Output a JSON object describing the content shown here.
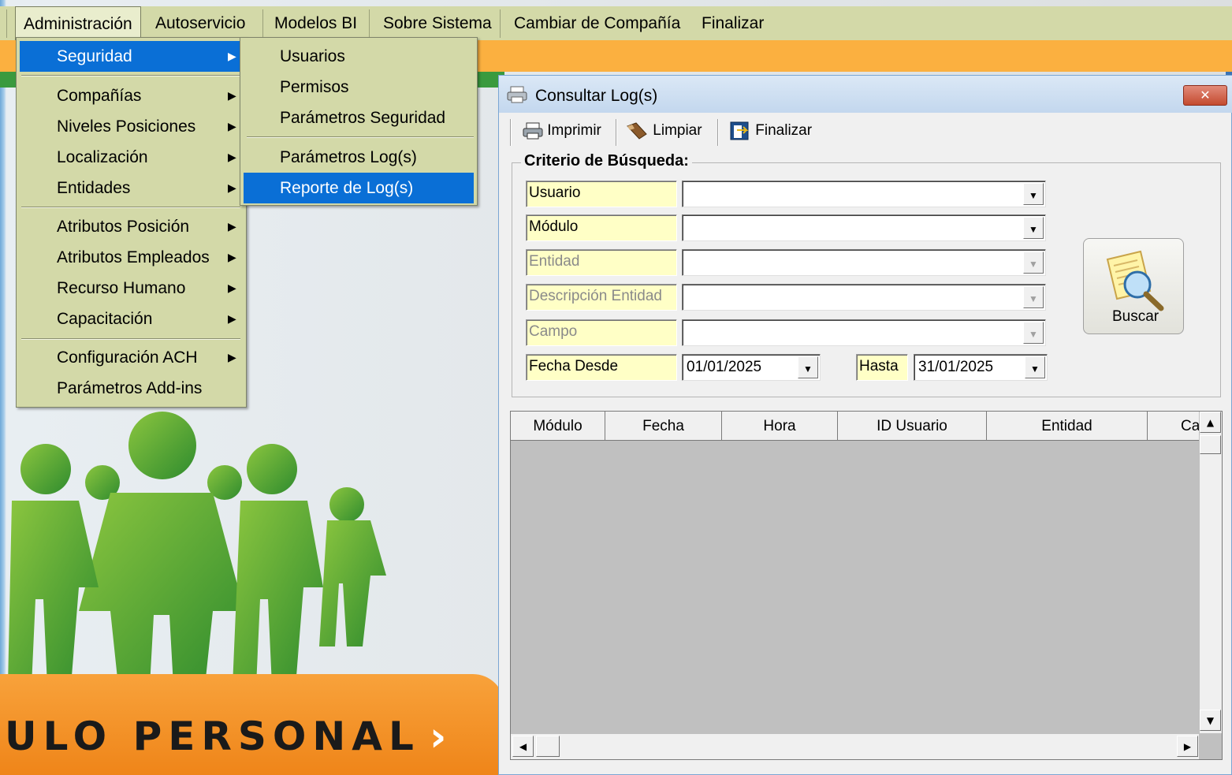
{
  "menubar": {
    "items": [
      "Administración",
      "Autoservicio",
      "Modelos BI",
      "Sobre Sistema",
      "Cambiar de Compañía",
      "Finalizar"
    ]
  },
  "admin_menu": {
    "items": [
      "Seguridad",
      "Compañías",
      "Niveles Posiciones",
      "Localización",
      "Entidades",
      "Atributos Posición",
      "Atributos Empleados",
      "Recurso Humano",
      "Capacitación",
      "Configuración ACH",
      "Parámetros Add-ins"
    ]
  },
  "security_menu": {
    "items": [
      "Usuarios",
      "Permisos",
      "Parámetros Seguridad",
      "Parámetros Log(s)",
      "Reporte de Log(s)"
    ]
  },
  "background": {
    "banner_text": "ULO PERSONAL",
    "banner_chevron": "›"
  },
  "dialog": {
    "title": "Consultar Log(s)",
    "close_label": "✕",
    "toolbar": {
      "print": "Imprimir",
      "clear": "Limpiar",
      "finish": "Finalizar"
    },
    "criteria_title": "Criterio de Búsqueda:",
    "fields": {
      "usuario": {
        "label": "Usuario",
        "value": ""
      },
      "modulo": {
        "label": "Módulo",
        "value": ""
      },
      "entidad": {
        "label": "Entidad",
        "value": ""
      },
      "descripcion": {
        "label": "Descripción Entidad",
        "value": ""
      },
      "campo": {
        "label": "Campo",
        "value": ""
      },
      "fecha_desde": {
        "label": "Fecha Desde",
        "value": "01/01/2025"
      },
      "hasta": {
        "label": "Hasta",
        "value": "31/01/2025"
      }
    },
    "search_button": "Buscar",
    "grid": {
      "columns": [
        "Módulo",
        "Fecha",
        "Hora",
        "ID Usuario",
        "Entidad",
        "Ca"
      ],
      "rows": []
    }
  },
  "colors": {
    "menubar": "#d3d9a8",
    "highlight": "#0a6fd6",
    "field_label_bg": "#ffffc6",
    "banner": "#f8a23b"
  }
}
